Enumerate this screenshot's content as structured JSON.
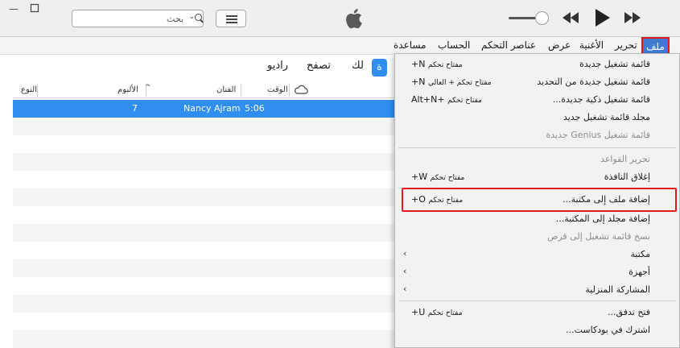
{
  "search": {
    "placeholder": "بحث"
  },
  "menubar": {
    "items": [
      "ملف",
      "تحرير",
      "الأغنية",
      "عرض",
      "عناصر التحكم",
      "الحساب",
      "مساعدة"
    ]
  },
  "navtabs": {
    "items": [
      "راديو",
      "تصفح",
      "لك",
      "مكتبة"
    ],
    "selected_visible": "ة"
  },
  "table": {
    "headers": {
      "type": "النوع",
      "album": "الألبوم",
      "artist": "الفنان",
      "time": "الوقت"
    },
    "rows": [
      {
        "type": "",
        "album": "7",
        "artist": "Nancy Ajram",
        "time": "5:06"
      }
    ]
  },
  "file_menu": {
    "items": [
      {
        "label": "قائمة تشغيل جديدة",
        "shortcut_ar": "مفتاح تحكم",
        "shortcut": "+N",
        "disabled": false
      },
      {
        "label": "قائمة تشغيل جديدة من التحديد",
        "shortcut_ar": "مفتاح تحكم + العالي",
        "shortcut": "+N",
        "disabled": false
      },
      {
        "label": "قائمة تشغيل ذكية جديدة...",
        "shortcut_ar": "مفتاح تحكم",
        "shortcut": "Alt+N+",
        "disabled": false
      },
      {
        "label": "مجلد قائمة تشغيل جديد",
        "shortcut_ar": "",
        "shortcut": "",
        "disabled": false
      },
      {
        "label": "قائمة تشغيل Genius جديدة",
        "shortcut_ar": "",
        "shortcut": "",
        "disabled": true
      },
      {
        "label": "تحرير القواعد",
        "shortcut_ar": "",
        "shortcut": "",
        "disabled": true
      },
      {
        "label": "إغلاق النافذة",
        "shortcut_ar": "مفتاح تحكم",
        "shortcut": "+W",
        "disabled": false
      },
      {
        "label": "إضافة ملف إلى مكتبة...",
        "shortcut_ar": "مفتاح تحكم",
        "shortcut": "+O",
        "disabled": false
      },
      {
        "label": "إضافة مجلد إلى المكتبة...",
        "shortcut_ar": "",
        "shortcut": "",
        "disabled": false
      },
      {
        "label": "نسخ قائمة تشغيل إلى قرص",
        "shortcut_ar": "",
        "shortcut": "",
        "disabled": true
      },
      {
        "label": "مكتبة",
        "shortcut_ar": "",
        "shortcut": "",
        "disabled": false,
        "submenu": true
      },
      {
        "label": "أجهزة",
        "shortcut_ar": "",
        "shortcut": "",
        "disabled": false,
        "submenu": true
      },
      {
        "label": "المشاركة المنزلية",
        "shortcut_ar": "",
        "shortcut": "",
        "disabled": false,
        "submenu": true
      },
      {
        "label": "فتح تدفق...",
        "shortcut_ar": "مفتاح تحكم",
        "shortcut": "+U",
        "disabled": false
      },
      {
        "label": "اشترك في بودكاست...",
        "shortcut_ar": "",
        "shortcut": "",
        "disabled": false
      }
    ]
  },
  "colors": {
    "accent": "#2f8ef0",
    "highlight_border": "#e01b1b",
    "menu_bg": "#f2f2f2"
  },
  "icons": [
    "minimize-icon",
    "maximize-icon",
    "search-icon",
    "list-view-icon",
    "apple-logo",
    "volume-slider",
    "rewind-icon",
    "play-icon",
    "fast-forward-icon",
    "cloud-icon",
    "sort-arrow-icon",
    "chevron-left-icon"
  ]
}
